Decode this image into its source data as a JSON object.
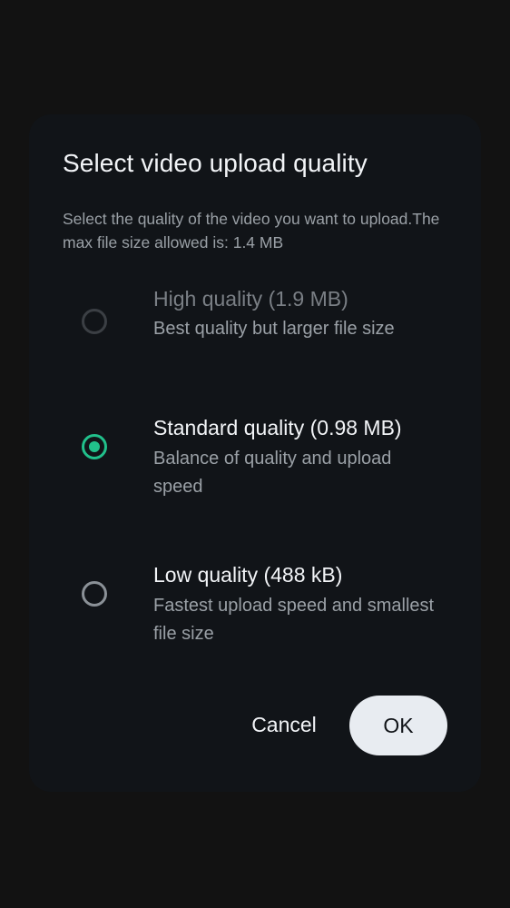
{
  "dialog": {
    "title": "Select video upload quality",
    "description": "Select the quality of the video you want to upload.The max file size allowed is: 1.4 MB",
    "options": [
      {
        "title": "High quality (1.9 MB)",
        "description": "Best quality but larger file size",
        "selected": false,
        "disabled": true
      },
      {
        "title": "Standard quality (0.98 MB)",
        "description": "Balance of quality and upload speed",
        "selected": true,
        "disabled": false
      },
      {
        "title": "Low quality (488 kB)",
        "description": "Fastest upload speed and smallest file size",
        "selected": false,
        "disabled": false
      }
    ],
    "cancel_label": "Cancel",
    "ok_label": "OK"
  },
  "colors": {
    "background": "#121212",
    "dialog_background": "#111418",
    "accent": "#21c08b",
    "primary_text": "#f2f4f7",
    "secondary_text": "#9aa0a6",
    "ok_button_background": "#e8ecf1"
  }
}
